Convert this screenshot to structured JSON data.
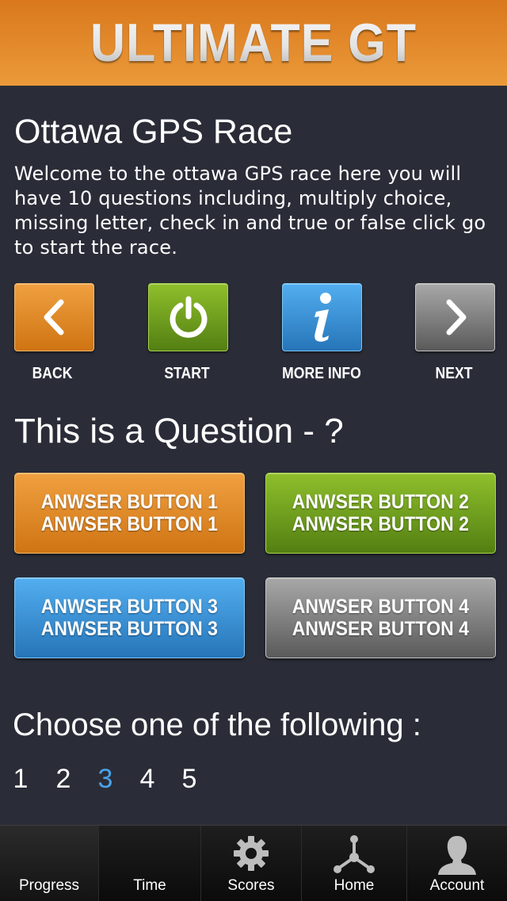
{
  "app": {
    "title": "ULTIMATE GT"
  },
  "race": {
    "title": "Ottawa GPS Race",
    "intro": "Welcome to the ottawa GPS race here you will have 10 questions including, multiply choice, missing letter, check in and true or false click go to start the race."
  },
  "nav_buttons": [
    {
      "label": "BACK",
      "icon": "chevron-left-icon",
      "color": "#e8891f"
    },
    {
      "label": "START",
      "icon": "power-icon",
      "color": "#6d9a1c"
    },
    {
      "label": "MORE INFO",
      "icon": "info-icon",
      "color": "#3a8fd6"
    },
    {
      "label": "NEXT",
      "icon": "chevron-right-icon",
      "color": "#8a8a8a"
    }
  ],
  "question": {
    "text": "This is a Question - ?"
  },
  "answers": [
    {
      "line1": "ANWSER BUTTON 1",
      "line2": "ANWSER BUTTON 1",
      "color": "#e8891f"
    },
    {
      "line1": "ANWSER BUTTON 2",
      "line2": "ANWSER BUTTON 2",
      "color": "#6d9a1c"
    },
    {
      "line1": "ANWSER BUTTON 3",
      "line2": "ANWSER BUTTON 3",
      "color": "#3a8fd6"
    },
    {
      "line1": "ANWSER BUTTON 4",
      "line2": "ANWSER BUTTON 4",
      "color": "#8a8a8a"
    }
  ],
  "choose": {
    "prompt": "Choose one of the following :",
    "options": [
      "1",
      "2",
      "3",
      "4",
      "5"
    ],
    "selected": "3",
    "selected_color": "#4aa3e8"
  },
  "tabbar": {
    "active": "Progress",
    "tabs": [
      {
        "label": "Progress",
        "icon": ""
      },
      {
        "label": "Time",
        "icon": ""
      },
      {
        "label": "Scores",
        "icon": "gear-icon"
      },
      {
        "label": "Home",
        "icon": "network-icon"
      },
      {
        "label": "Account",
        "icon": "user-icon"
      }
    ]
  }
}
